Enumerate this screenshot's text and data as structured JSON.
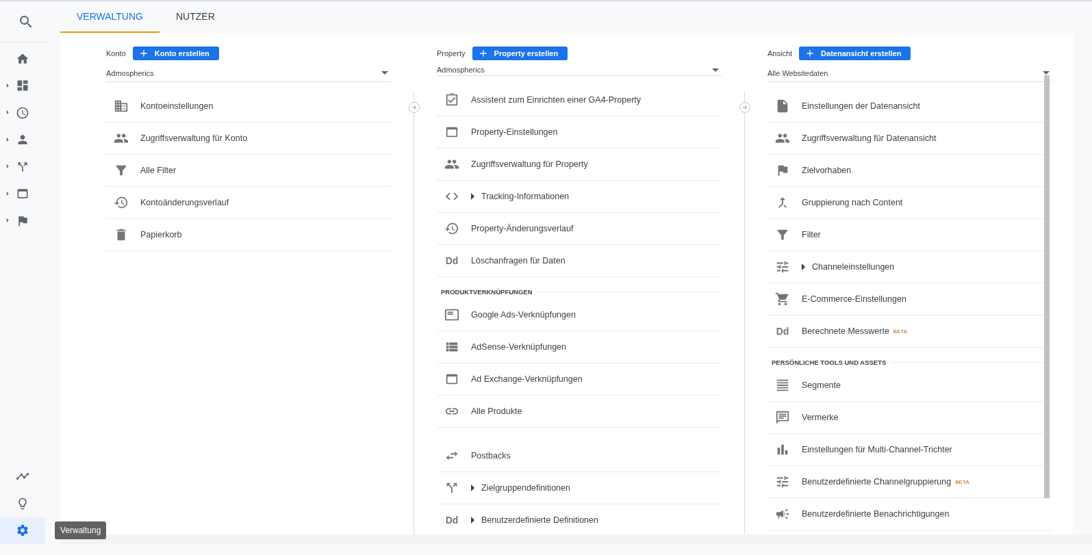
{
  "sidebar": {
    "search": {
      "selected": false
    },
    "nav": [
      {
        "expandable": false,
        "selected": false
      },
      {
        "expandable": true,
        "selected": false
      },
      {
        "expandable": true,
        "selected": false
      },
      {
        "expandable": true,
        "selected": false
      },
      {
        "expandable": true,
        "selected": false
      },
      {
        "expandable": true,
        "selected": false
      },
      {
        "expandable": true,
        "selected": false
      }
    ],
    "bottom": [
      {
        "selected": false
      },
      {
        "selected": false
      },
      {
        "selected": true
      }
    ],
    "tooltip": "Verwaltung"
  },
  "tabs": [
    {
      "label": "VERWALTUNG",
      "selected": true
    },
    {
      "label": "NUTZER",
      "selected": false
    }
  ],
  "columns": [
    {
      "label": "Konto",
      "button": "Konto erstellen",
      "dropdown_value": "Admospherics",
      "items": [
        {
          "kind": "link",
          "label": "Kontoeinstellungen",
          "expandable": false
        },
        {
          "kind": "link",
          "label": "Zugriffsverwaltung für Konto",
          "expandable": false
        },
        {
          "kind": "link",
          "label": "Alle Filter",
          "expandable": false
        },
        {
          "kind": "link",
          "label": "Kontoänderungsverlauf",
          "expandable": false
        },
        {
          "kind": "link",
          "label": "Papierkorb",
          "expandable": false
        }
      ]
    },
    {
      "label": "Property",
      "button": "Property erstellen",
      "dropdown_value": "Admospherics",
      "items": [
        {
          "kind": "link",
          "label": "Assistent zum Einrichten einer GA4-Property",
          "expandable": false
        },
        {
          "kind": "link",
          "label": "Property-Einstellungen",
          "expandable": false
        },
        {
          "kind": "link",
          "label": "Zugriffsverwaltung für Property",
          "expandable": false
        },
        {
          "kind": "link",
          "label": "Tracking-Informationen",
          "expandable": true
        },
        {
          "kind": "link",
          "label": "Property-Änderungsverlauf",
          "expandable": false
        },
        {
          "kind": "link",
          "label": "Löschanfragen für Daten",
          "expandable": false,
          "icon_text": "Dd"
        },
        {
          "kind": "section",
          "label": "PRODUKTVERKNÜPFUNGEN"
        },
        {
          "kind": "link",
          "label": "Google Ads-Verknüpfungen",
          "expandable": false
        },
        {
          "kind": "link",
          "label": "AdSense-Verknüpfungen",
          "expandable": false
        },
        {
          "kind": "link",
          "label": "Ad Exchange-Verknüpfungen",
          "expandable": false
        },
        {
          "kind": "link",
          "label": "Alle Produkte",
          "expandable": false
        },
        {
          "kind": "spacer"
        },
        {
          "kind": "link",
          "label": "Postbacks",
          "expandable": false
        },
        {
          "kind": "link",
          "label": "Zielgruppendefinitionen",
          "expandable": true
        },
        {
          "kind": "link",
          "label": "Benutzerdefinierte Definitionen",
          "expandable": true,
          "icon_text": "Dd"
        }
      ]
    },
    {
      "label": "Ansicht",
      "button": "Datenansicht erstellen",
      "dropdown_value": "Alle Websitedaten",
      "items": [
        {
          "kind": "link",
          "label": "Einstellungen der Datenansicht",
          "expandable": false
        },
        {
          "kind": "link",
          "label": "Zugriffsverwaltung für Datenansicht",
          "expandable": false
        },
        {
          "kind": "link",
          "label": "Zielvorhaben",
          "expandable": false
        },
        {
          "kind": "link",
          "label": "Gruppierung nach Content",
          "expandable": false
        },
        {
          "kind": "link",
          "label": "Filter",
          "expandable": false
        },
        {
          "kind": "link",
          "label": "Channeleinstellungen",
          "expandable": true
        },
        {
          "kind": "link",
          "label": "E-Commerce-Einstellungen",
          "expandable": false
        },
        {
          "kind": "link",
          "label": "Berechnete Messwerte",
          "expandable": false,
          "icon_text": "Dd",
          "badge": "BETA"
        },
        {
          "kind": "section",
          "label": "PERSÖNLICHE TOOLS UND ASSETS"
        },
        {
          "kind": "link",
          "label": "Segmente",
          "expandable": false
        },
        {
          "kind": "link",
          "label": "Vermerke",
          "expandable": false
        },
        {
          "kind": "link",
          "label": "Einstellungen für Multi-Channel-Trichter",
          "expandable": false
        },
        {
          "kind": "link",
          "label": "Benutzerdefinierte Channelgruppierung",
          "expandable": false,
          "badge": "BETA"
        },
        {
          "kind": "link",
          "label": "Benutzerdefinierte Benachrichtigungen",
          "expandable": false
        }
      ]
    }
  ]
}
